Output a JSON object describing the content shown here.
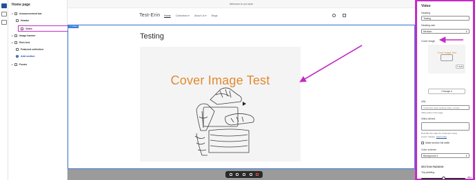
{
  "sidebar": {
    "title": "Home page",
    "items": [
      {
        "label": "Announcement bar",
        "bold": true
      },
      {
        "label": "Header",
        "bold": true
      },
      {
        "label": "Video",
        "bold": true
      },
      {
        "label": "Image banner",
        "bold": true
      },
      {
        "label": "Rich text",
        "bold": true
      },
      {
        "label": "Featured collection",
        "bold": true
      },
      {
        "label": "Add section",
        "bold": true
      },
      {
        "label": "Footer",
        "bold": true
      }
    ]
  },
  "preview": {
    "announcement": "Welcome to our store",
    "logo": "Test-Erin",
    "nav": [
      "Home",
      "Collections",
      "About Us",
      "Blogs"
    ],
    "section_tag": "Video",
    "heading": "Testing",
    "cover_text": "Cover Image Test"
  },
  "panel": {
    "title": "Video",
    "heading_label": "Heading",
    "heading_value": "Testing",
    "heading_size_label": "Heading size",
    "heading_size_value": "Medium",
    "cover_image_label": "Cover image",
    "thumb_text": "Cover Image Test",
    "edit_label": "Edit",
    "change_label": "Change",
    "url_label": "URL",
    "url_placeholder": "Customize video settings video_url plus",
    "url_help": "Video plays in the page.",
    "alt_label": "Video alt text",
    "alt_help_1": "Describe the video for customers using",
    "alt_help_2": "screen readers.",
    "alt_help_link": "Learn more",
    "full_width_label": "Make section full width",
    "color_scheme_label": "Color scheme",
    "color_scheme_value": "Background 1",
    "section_padding_label": "SECTION PADDING",
    "top_padding_label": "Top padding",
    "top_padding_value": "28px",
    "top_padding_fraction": 0.5
  },
  "colors": {
    "highlight": "#c42bc4",
    "accent": "#1f5199",
    "section_outline": "#3b7ddd",
    "cover_text": "#e08a2e"
  }
}
